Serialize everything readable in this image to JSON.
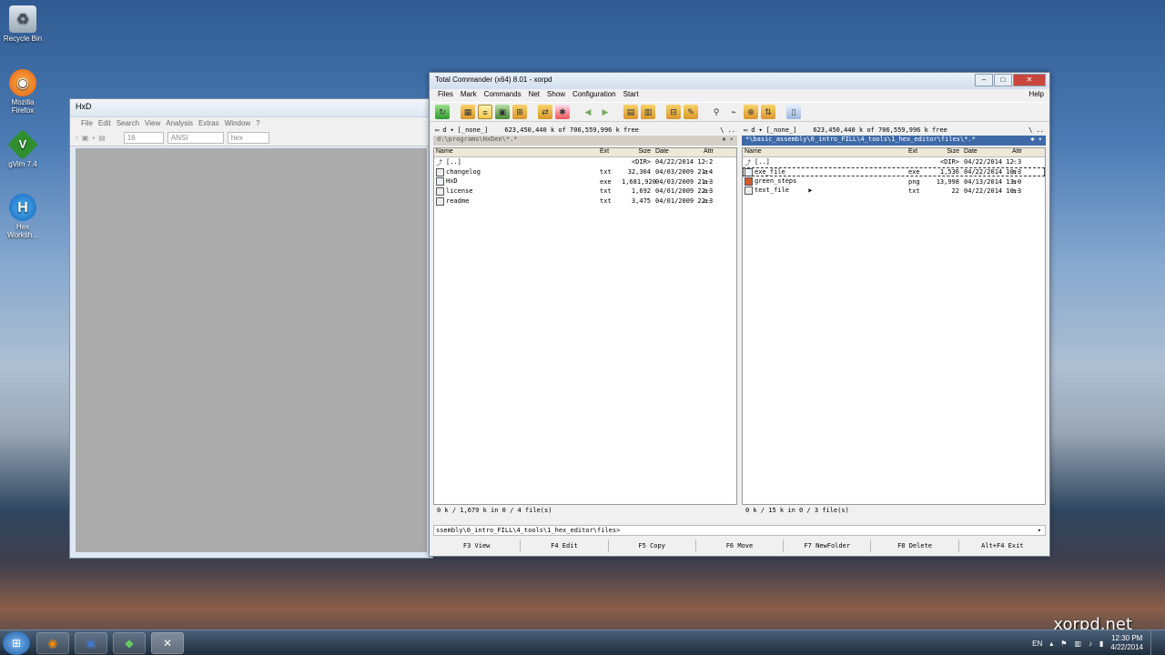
{
  "desktop": {
    "icons": [
      {
        "label": "Recycle Bin",
        "icon": "recycle-bin-icon"
      },
      {
        "label": "Mozilla Firefox",
        "icon": "firefox-icon"
      },
      {
        "label": "gVim 7.4",
        "icon": "gvim-icon"
      },
      {
        "label": "Hex Worksh...",
        "icon": "hex-workshop-icon"
      }
    ],
    "watermark": "xorpd.net"
  },
  "hxd": {
    "title": "HxD",
    "menu": [
      "File",
      "Edit",
      "Search",
      "View",
      "Analysis",
      "Extras",
      "Window",
      "?"
    ],
    "bytes_per_row": "16",
    "charset": "ANSI",
    "offset_base": "hex"
  },
  "tc": {
    "title": "Total Commander (x64) 8.01 - xorpd",
    "menu": [
      "Files",
      "Mark",
      "Commands",
      "Net",
      "Show",
      "Configuration",
      "Start"
    ],
    "help": "Help",
    "left": {
      "drive": "d",
      "volume": "[_none_]",
      "free": "623,450,440 k of 706,559,996 k free",
      "path": "d:\\programs\\HxDen\\*.*",
      "headers": {
        "name": "Name",
        "ext": "Ext",
        "size": "Size",
        "date": "Date",
        "attr": "Attr"
      },
      "files": [
        {
          "name": "[..]",
          "ext": "",
          "size": "<DIR>",
          "date": "04/22/2014 12:2",
          "attr": "-",
          "icon": "up"
        },
        {
          "name": "changelog",
          "ext": "txt",
          "size": "32,304",
          "date": "04/03/2009 21:4",
          "attr": "a-",
          "icon": "file"
        },
        {
          "name": "HxD",
          "ext": "exe",
          "size": "1,681,920",
          "date": "04/03/2009 21:3",
          "attr": "a-",
          "icon": "exe"
        },
        {
          "name": "license",
          "ext": "txt",
          "size": "1,692",
          "date": "04/01/2009 22:3",
          "attr": "a-",
          "icon": "file"
        },
        {
          "name": "readme",
          "ext": "txt",
          "size": "3,475",
          "date": "04/01/2009 22:3",
          "attr": "a-",
          "icon": "file"
        }
      ],
      "status": "0 k / 1,679 k in 0 / 4 file(s)"
    },
    "right": {
      "drive": "d",
      "volume": "[_none_]",
      "free": "623,450,440 k of 706,559,996 k free",
      "path": "*\\basic_assembly\\0_intro_FILL\\4_tools\\1_hex_editor\\files\\*.*",
      "headers": {
        "name": "Name",
        "ext": "Ext",
        "size": "Size",
        "date": "Date",
        "attr": "Attr"
      },
      "files": [
        {
          "name": "[..]",
          "ext": "",
          "size": "<DIR>",
          "date": "04/22/2014 12:3",
          "attr": "-",
          "icon": "up"
        },
        {
          "name": "exe_file",
          "ext": "exe",
          "size": "1,536",
          "date": "04/22/2014 10:3",
          "attr": "a-",
          "icon": "exe"
        },
        {
          "name": "green_steps",
          "ext": "png",
          "size": "13,998",
          "date": "04/13/2014 13:0",
          "attr": "a-",
          "icon": "img"
        },
        {
          "name": "text_file",
          "ext": "txt",
          "size": "22",
          "date": "04/22/2014 10:3",
          "attr": "a-",
          "icon": "file"
        }
      ],
      "status": "0 k / 15 k in 0 / 3 file(s)"
    },
    "cmdline": "ssembly\\0_intro_FILL\\4_tools\\1_hex_editor\\files>",
    "fkeys": [
      "F3 View",
      "F4 Edit",
      "F5 Copy",
      "F6 Move",
      "F7 NewFolder",
      "F8 Delete",
      "Alt+F4 Exit"
    ]
  },
  "taskbar": {
    "language": "EN",
    "time": "12:30 PM",
    "date": "4/22/2014"
  }
}
